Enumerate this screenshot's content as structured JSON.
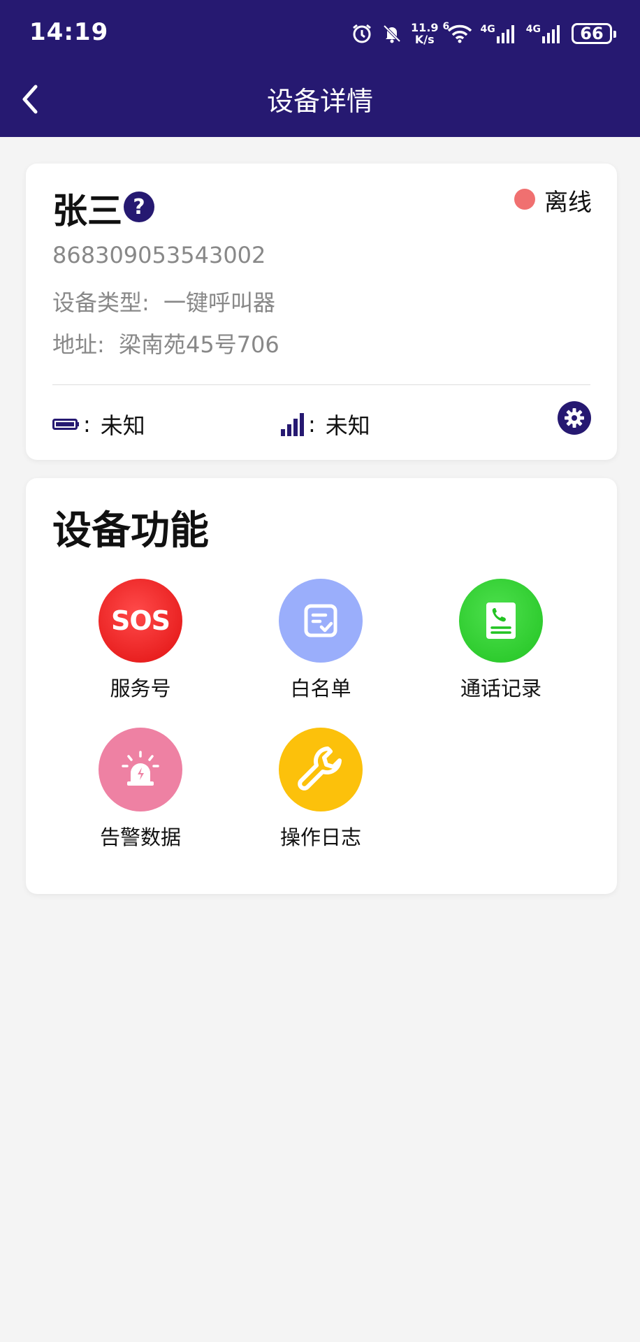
{
  "status_bar": {
    "time": "14:19",
    "net_speed_value": "11.9",
    "net_speed_unit": "K/s",
    "wifi_label": "6",
    "sim1_label": "4G",
    "sim2_label": "4G",
    "battery": "66"
  },
  "header": {
    "title": "设备详情"
  },
  "device": {
    "name": "张三",
    "status": "离线",
    "id": "868309053543002",
    "type_label": "设备类型:",
    "type_value": "一键呼叫器",
    "address_label": "地址:",
    "address_value": "梁南苑45号706",
    "battery_sep": ":",
    "battery_value": "未知",
    "signal_sep": ":",
    "signal_value": "未知"
  },
  "functions": {
    "title": "设备功能",
    "items": [
      {
        "label": "服务号",
        "icon": "sos-icon",
        "color": "#e81a1a"
      },
      {
        "label": "白名单",
        "icon": "checklist-icon",
        "color": "#9aaefb"
      },
      {
        "label": "通话记录",
        "icon": "call-record-icon",
        "color": "#2ec92e"
      },
      {
        "label": "告警数据",
        "icon": "alarm-light-icon",
        "color": "#ee81a3"
      },
      {
        "label": "操作日志",
        "icon": "wrench-icon",
        "color": "#fcc10b"
      }
    ],
    "sos_text": "SOS"
  },
  "colors": {
    "primary": "#261971",
    "offline": "#f07070",
    "background": "#f4f4f4"
  }
}
